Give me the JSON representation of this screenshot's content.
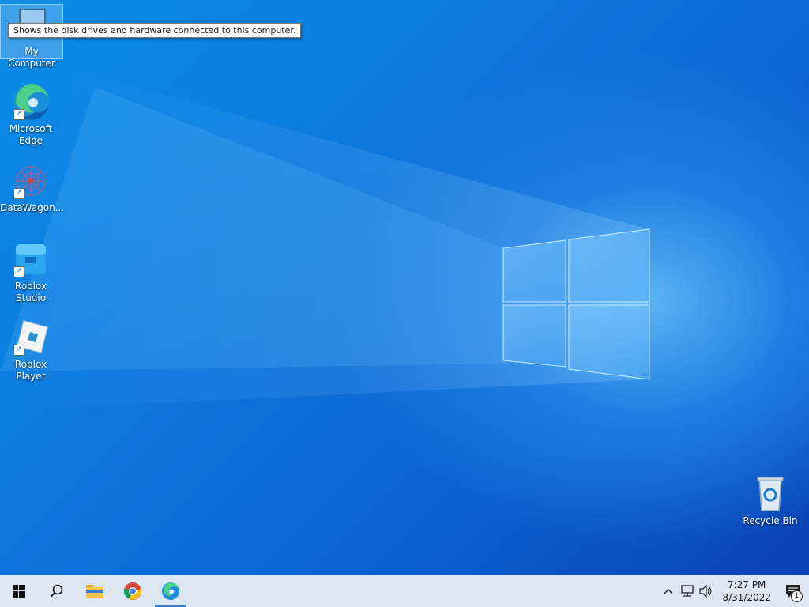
{
  "desktop": {
    "icons": [
      {
        "label": "My Computer"
      },
      {
        "label": "Microsoft\nEdge"
      },
      {
        "label": "DataWagon..."
      },
      {
        "label": "Roblox Studio"
      },
      {
        "label": "Roblox Player"
      },
      {
        "label": "Recycle Bin"
      }
    ],
    "tooltip": "Shows the disk drives and hardware connected to this computer."
  },
  "taskbar": {
    "clock_time": "7:27 PM",
    "clock_date": "8/31/2022",
    "notification_count": "1",
    "pinned": [
      "start",
      "search",
      "file-explorer",
      "chrome",
      "edge"
    ]
  },
  "colors": {
    "accent": "#3a7bd5",
    "taskbar_bg": "#dde6f2"
  }
}
